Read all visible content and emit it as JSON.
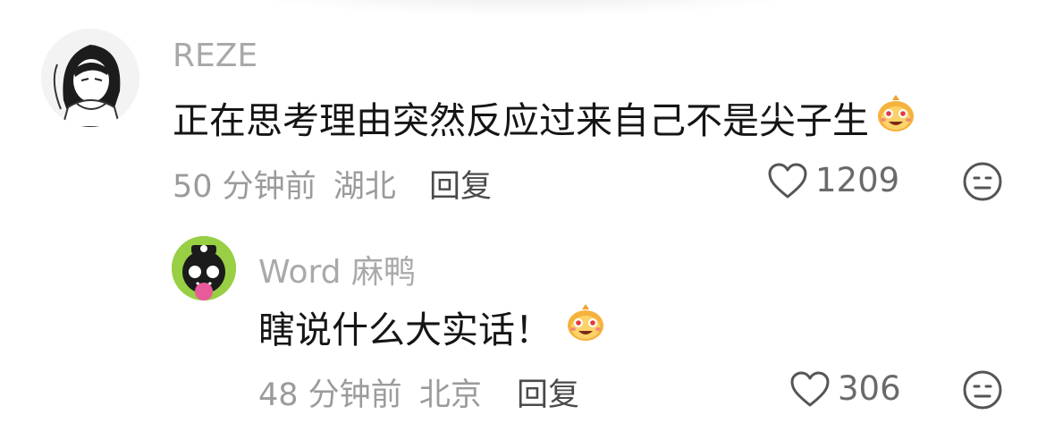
{
  "comments": [
    {
      "username": "REZE",
      "text": "正在思考理由突然反应过来自己不是尖子生",
      "emoji_icon": "grinning-dough-emoji",
      "time": "50 分钟前",
      "location": "湖北",
      "reply_label": "回复",
      "like_count": "1209",
      "reaction_icon": "neutral-face-icon"
    },
    {
      "username": "Word 麻鸭",
      "text": "瞎说什么大实话！",
      "emoji_icon": "grinning-dough-emoji",
      "time": "48 分钟前",
      "location": "北京",
      "reply_label": "回复",
      "like_count": "306",
      "reaction_icon": "neutral-face-icon"
    }
  ],
  "colors": {
    "username": "#a9a9a9",
    "text": "#151515",
    "meta": "#9b9b9b",
    "icon": "#555555"
  }
}
